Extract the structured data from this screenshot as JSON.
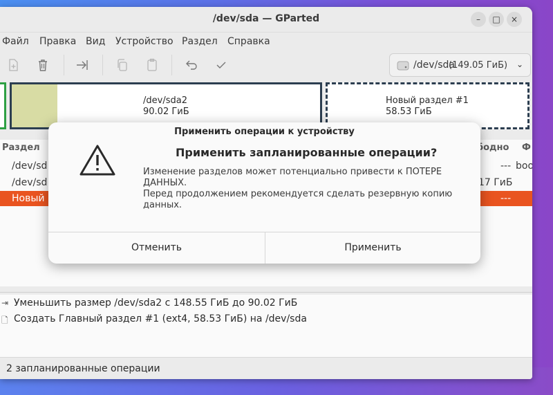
{
  "window": {
    "title": "/dev/sda — GParted",
    "controls": {
      "minimize": "–",
      "maximize": "□",
      "close": "×"
    }
  },
  "menu": [
    "Файл",
    "Правка",
    "Вид",
    "Устройство",
    "Раздел",
    "Справка"
  ],
  "toolbar": {
    "icons": [
      "new-partition-icon",
      "delete-icon",
      "resize-move-icon",
      "copy-icon",
      "paste-icon",
      "undo-icon",
      "apply-icon"
    ],
    "device_name": "/dev/sda",
    "device_size": "(149.05 ГиБ)"
  },
  "partition_map": [
    {
      "name": "",
      "size": "",
      "border_color": "#2ea043"
    },
    {
      "name": "/dev/sda2",
      "size": "90.02 ГиБ",
      "border_color": "#2c3e50",
      "used_fill": "#d8dca4"
    },
    {
      "name": "Новый раздел #1",
      "size": "58.53 ГиБ",
      "border_color": "#2c3e50",
      "border_style": "dashed"
    }
  ],
  "partition_list": {
    "headers": {
      "partition": "Раздел",
      "free": "бодно",
      "flags": "Ф"
    },
    "rows": [
      {
        "name": "/dev/sd",
        "free": "---",
        "flags": "boo"
      },
      {
        "name": "/dev/sd",
        "free": "17 ГиБ",
        "flags": ""
      },
      {
        "name": "Новый",
        "free": "---",
        "flags": "",
        "selected": true
      }
    ],
    "selection_color": "#e95420"
  },
  "operations": [
    {
      "icon": "resize-move-icon",
      "text": "Уменьшить размер /dev/sda2 с 148.55 ГиБ до 90.02 ГиБ"
    },
    {
      "icon": "new-partition-icon",
      "text": "Создать Главный раздел #1 (ext4, 58.53 ГиБ) на /dev/sda"
    }
  ],
  "status": "2 запланированные операции",
  "dialog": {
    "title": "Применить операции к устройству",
    "heading": "Применить запланированные операции?",
    "body_lines": [
      "Изменение разделов может потенциально привести к ПОТЕРЕ",
      "ДАННЫХ.",
      "Перед продолжением рекомендуется сделать резервную копию",
      "данных."
    ],
    "icon": "warning-icon",
    "cancel_label": "Отменить",
    "apply_label": "Применить"
  }
}
